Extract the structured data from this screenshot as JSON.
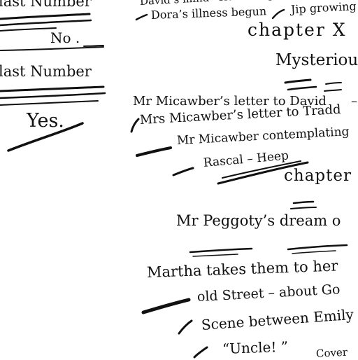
{
  "left_column": {
    "last_number_top": "last Number",
    "no": "No .",
    "last_number": "last Number",
    "yes": "Yes."
  },
  "notes": {
    "davids_mind": "David’s mind– old feeling– supposi",
    "dora_illness": "Dora’s illness begun",
    "jip_growing": "Jip growing",
    "chapter_x": "chapter X",
    "mysterious": "Mysteriou",
    "micawber_letter_david": "Mr Micawber’s letter to David",
    "dash_1": "–",
    "mrs_micawber_letter": "Mrs Micawber’s letter to Tradd",
    "micawber_contemplating": "Mr Micawber contemplating",
    "rascal": "Rascal – Heep",
    "chapter_2": "chapter",
    "peggoty_dream": "Mr Peggoty’s dream o",
    "martha": "Martha takes them to her",
    "old_street": "old Street – about Go",
    "scene_emily": "Scene between Emily",
    "uncle": "“Uncle! ”",
    "cover": "Cover"
  },
  "colors": {
    "ink": "#111111",
    "paper": "#ffffff"
  }
}
